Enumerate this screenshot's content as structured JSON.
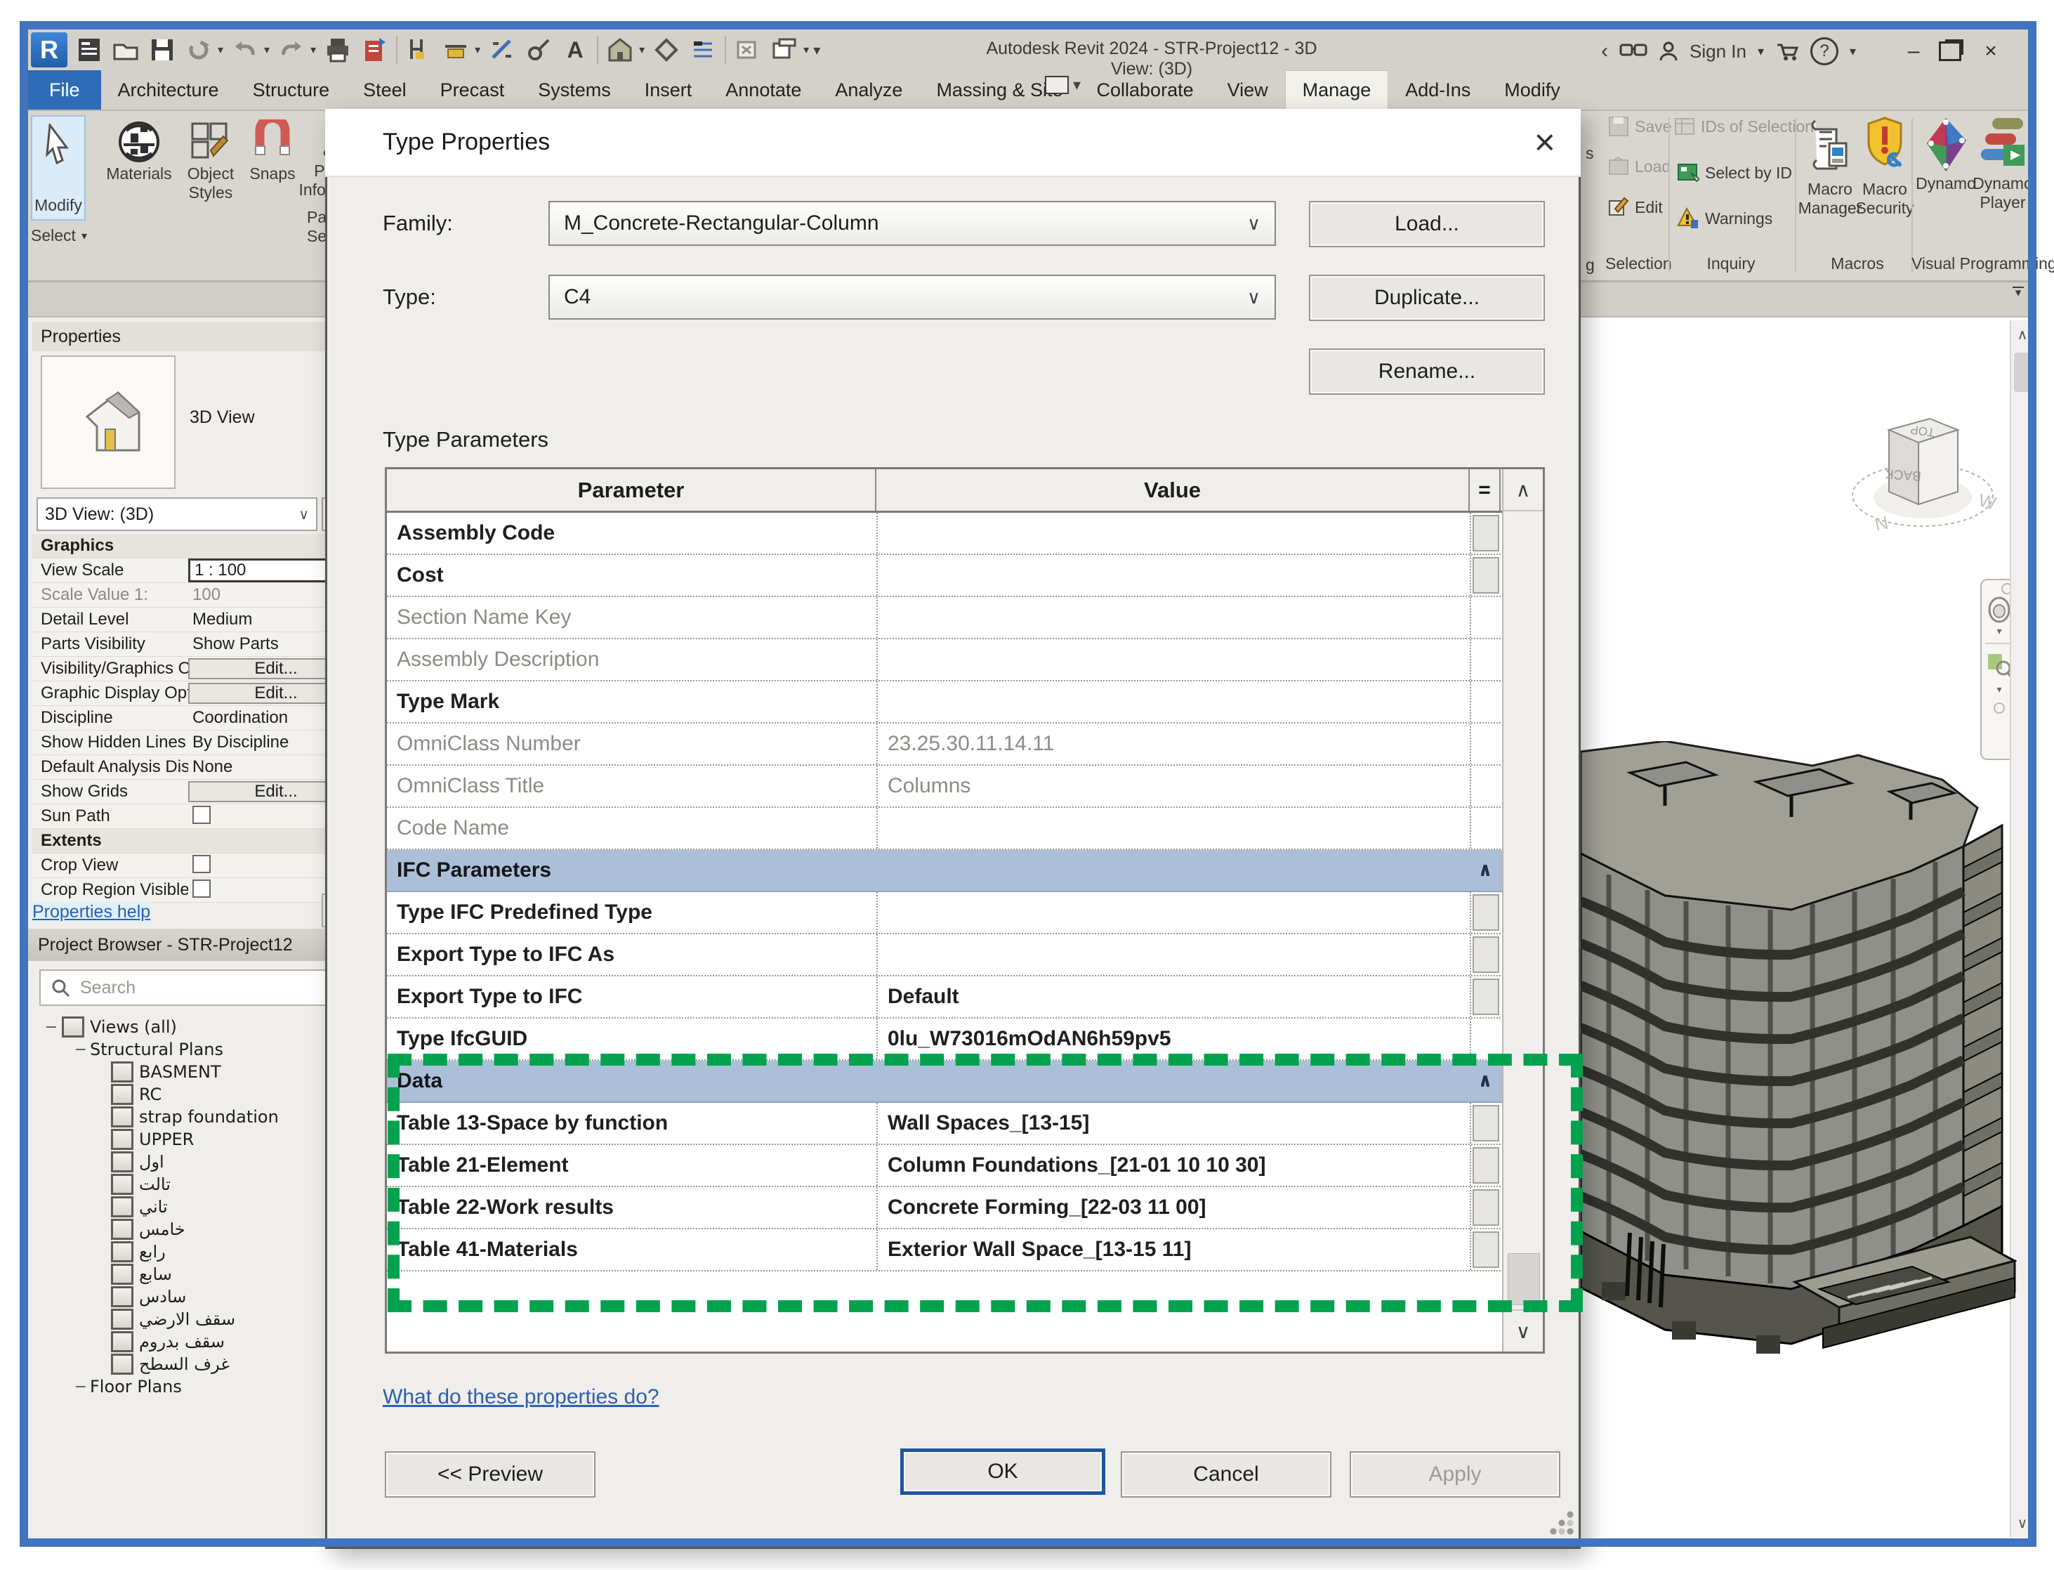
{
  "meta": {
    "app_title": "Autodesk Revit 2024 - STR-Project12 - 3D View: (3D)",
    "sign_in": "Sign In",
    "text_tool": "A"
  },
  "icons": {
    "caret": "▾",
    "chevron_down": "∨",
    "chevron_up": "∧",
    "collapse": "∧",
    "back_arrow": "‹",
    "close": "×",
    "minimize": "–",
    "help": "?",
    "equals": "=",
    "grid": "▦",
    "expander_minus": "−"
  },
  "tabs": [
    {
      "label": "File",
      "kind": "file"
    },
    {
      "label": "Architecture",
      "kind": ""
    },
    {
      "label": "Structure",
      "kind": ""
    },
    {
      "label": "Steel",
      "kind": ""
    },
    {
      "label": "Precast",
      "kind": ""
    },
    {
      "label": "Systems",
      "kind": ""
    },
    {
      "label": "Insert",
      "kind": ""
    },
    {
      "label": "Annotate",
      "kind": ""
    },
    {
      "label": "Analyze",
      "kind": ""
    },
    {
      "label": "Massing & Site",
      "kind": ""
    },
    {
      "label": "Collaborate",
      "kind": ""
    },
    {
      "label": "View",
      "kind": ""
    },
    {
      "label": "Manage",
      "kind": "active"
    },
    {
      "label": "Add-Ins",
      "kind": ""
    },
    {
      "label": "Modify",
      "kind": ""
    }
  ],
  "ribbon": {
    "left": {
      "modify": "Modify",
      "select": "Select",
      "materials": "Materials",
      "object_styles_1": "Object",
      "object_styles_2": "Styles",
      "snaps": "Snaps",
      "project_information_1": "Project",
      "project_information_2": "Information",
      "fragment_para": "Para",
      "fragment_se": "Se"
    },
    "right": {
      "fragment_top": "s",
      "fragment_bottom": "g",
      "save": "Save",
      "load": "Load",
      "edit": "Edit",
      "ids_of_selection": "IDs of Selection",
      "select_by_id": "Select by ID",
      "warnings": "Warnings",
      "macro_manager_1": "Macro",
      "macro_manager_2": "Manager",
      "macro_security_1": "Macro",
      "macro_security_2": "Security",
      "dynamo": "Dynamo",
      "dynamo_player_1": "Dynamo",
      "dynamo_player_2": "Player",
      "labels": {
        "selection": "Selection",
        "inquiry": "Inquiry",
        "macros": "Macros",
        "visual_programming": "Visual Programming"
      }
    }
  },
  "props": {
    "header": "Properties",
    "type_name": "3D View",
    "selector": "3D View: (3D)",
    "help": "Properties help",
    "rows": [
      {
        "label": "Graphics",
        "value": "",
        "kind": "group"
      },
      {
        "label": "View Scale",
        "value": "1 : 100",
        "kind": "input"
      },
      {
        "label": "Scale Value    1:",
        "value": "100",
        "kind": "muted"
      },
      {
        "label": "Detail Level",
        "value": "Medium",
        "kind": ""
      },
      {
        "label": "Parts Visibility",
        "value": "Show Parts",
        "kind": ""
      },
      {
        "label": "Visibility/Graphics Overri...",
        "value": "Edit...",
        "kind": "button"
      },
      {
        "label": "Graphic Display Options",
        "value": "Edit...",
        "kind": "button"
      },
      {
        "label": "Discipline",
        "value": "Coordination",
        "kind": ""
      },
      {
        "label": "Show Hidden Lines",
        "value": "By Discipline",
        "kind": ""
      },
      {
        "label": "Default Analysis Display S...",
        "value": "None",
        "kind": ""
      },
      {
        "label": "Show Grids",
        "value": "Edit...",
        "kind": "button"
      },
      {
        "label": "Sun Path",
        "value": "",
        "kind": "checkbox"
      },
      {
        "label": "Extents",
        "value": "",
        "kind": "group"
      },
      {
        "label": "Crop View",
        "value": "",
        "kind": "checkbox"
      },
      {
        "label": "Crop Region Visible",
        "value": "",
        "kind": "checkbox"
      }
    ]
  },
  "browser": {
    "header": "Project Browser - STR-Project12",
    "search_placeholder": "Search",
    "tree": [
      {
        "label": "Views (all)",
        "lvl": "0",
        "exp": "−"
      },
      {
        "label": "Structural Plans",
        "lvl": "1",
        "exp": "−"
      },
      {
        "label": "BASMENT",
        "lvl": "2",
        "exp": ""
      },
      {
        "label": "RC",
        "lvl": "2",
        "exp": ""
      },
      {
        "label": "strap foundation",
        "lvl": "2",
        "exp": ""
      },
      {
        "label": "UPPER",
        "lvl": "2",
        "exp": ""
      },
      {
        "label": "اول",
        "lvl": "2",
        "exp": ""
      },
      {
        "label": "تالت",
        "lvl": "2",
        "exp": ""
      },
      {
        "label": "تاني",
        "lvl": "2",
        "exp": ""
      },
      {
        "label": "خامس",
        "lvl": "2",
        "exp": ""
      },
      {
        "label": "رابع",
        "lvl": "2",
        "exp": ""
      },
      {
        "label": "سابع",
        "lvl": "2",
        "exp": ""
      },
      {
        "label": "سادس",
        "lvl": "2",
        "exp": ""
      },
      {
        "label": "سقف الارضي",
        "lvl": "2",
        "exp": ""
      },
      {
        "label": "سقف بدروم",
        "lvl": "2",
        "exp": ""
      },
      {
        "label": "غرف السطح",
        "lvl": "2",
        "exp": ""
      },
      {
        "label": "Floor Plans",
        "lvl": "1",
        "exp": "−"
      }
    ]
  },
  "dialog": {
    "title": "Type Properties",
    "family_label": "Family:",
    "family_value": "M_Concrete-Rectangular-Column",
    "type_label": "Type:",
    "type_value": "C4",
    "load": "Load...",
    "duplicate": "Duplicate...",
    "rename": "Rename...",
    "type_parameters": "Type Parameters",
    "link": "What do these properties do?",
    "preview": "<< Preview",
    "ok": "OK",
    "cancel": "Cancel",
    "apply": "Apply",
    "table": {
      "param_header": "Parameter",
      "value_header": "Value",
      "rows": [
        {
          "param": "Assembly Code",
          "value": "",
          "cls": "btn"
        },
        {
          "param": "Cost",
          "value": "",
          "cls": "btn"
        },
        {
          "param": "Section Name Key",
          "value": "",
          "cls": "muted"
        },
        {
          "param": "Assembly Description",
          "value": "",
          "cls": "muted"
        },
        {
          "param": "Type Mark",
          "value": "",
          "cls": ""
        },
        {
          "param": "OmniClass Number",
          "value": "23.25.30.11.14.11",
          "cls": "muted"
        },
        {
          "param": "OmniClass Title",
          "value": "Columns",
          "cls": "muted"
        },
        {
          "param": "Code Name",
          "value": "",
          "cls": "muted"
        },
        {
          "param": "IFC Parameters",
          "value": "",
          "cls": "section"
        },
        {
          "param": "Type IFC Predefined Type",
          "value": "",
          "cls": "btn"
        },
        {
          "param": "Export Type to IFC As",
          "value": "",
          "cls": "btn"
        },
        {
          "param": "Export Type to IFC",
          "value": "Default",
          "cls": "btn"
        },
        {
          "param": "Type IfcGUID",
          "value": "0lu_W73016mOdAN6h59pv5",
          "cls": ""
        },
        {
          "param": "Data",
          "value": "",
          "cls": "section"
        },
        {
          "param": "Table 13-Space by function",
          "value": "Wall Spaces_[13-15]",
          "cls": "btn"
        },
        {
          "param": "Table 21-Element",
          "value": "Column Foundations_[21-01 10 10 30]",
          "cls": "btn"
        },
        {
          "param": "Table 22-Work results",
          "value": "Concrete Forming_[22-03 11 00]",
          "cls": "btn"
        },
        {
          "param": "Table 41-Materials",
          "value": "Exterior Wall Space_[13-15 11]",
          "cls": "btn"
        }
      ]
    }
  },
  "viewcube": {
    "top": "TOP",
    "back": "BACK",
    "north": "N",
    "west": "W"
  },
  "colors": {
    "window_border": "#4273bd",
    "highlight_green": "#00a24d",
    "section_header": "#abc0d8",
    "link_blue": "#2d5fb0",
    "ok_border": "#2055a0"
  }
}
